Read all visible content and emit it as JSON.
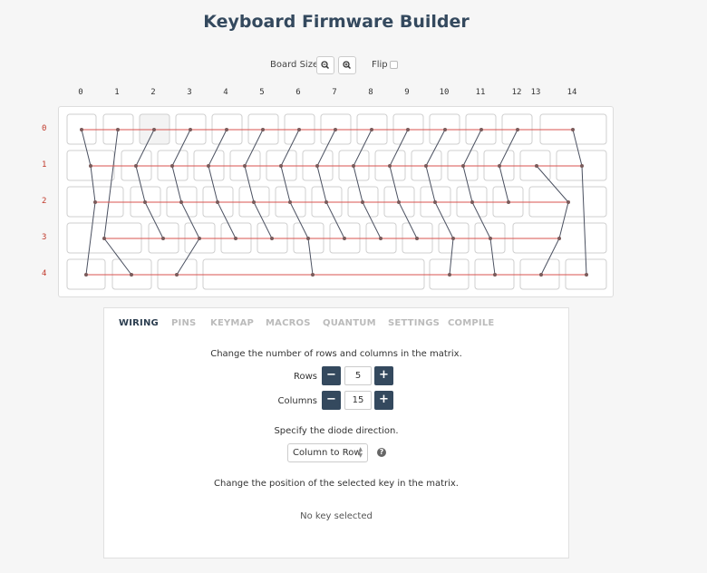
{
  "title": "Keyboard Firmware Builder",
  "toolbar": {
    "board_size_label": "Board Size",
    "zoom_out_icon": "zoom-out-icon",
    "zoom_in_icon": "zoom-in-icon",
    "flip_label": "Flip",
    "flip_checked": false
  },
  "matrix": {
    "col_labels": [
      "0",
      "1",
      "2",
      "3",
      "4",
      "5",
      "6",
      "7",
      "8",
      "9",
      "10",
      "11",
      "12",
      "13",
      "14"
    ],
    "row_labels": [
      "0",
      "1",
      "2",
      "3",
      "4"
    ],
    "wire_color": "#d9534f",
    "col_wire_color": "#4a5060"
  },
  "tabs": [
    "WIRING",
    "PINS",
    "KEYMAP",
    "MACROS",
    "QUANTUM",
    "SETTINGS",
    "COMPILE"
  ],
  "active_tab": "WIRING",
  "wiring": {
    "matrix_text": "Change the number of rows and columns in the matrix.",
    "rows_label": "Rows",
    "rows_value": "5",
    "columns_label": "Columns",
    "columns_value": "15",
    "decrement_label": "−",
    "increment_label": "+",
    "diode_text": "Specify the diode direction.",
    "diode_value": "Column to Row",
    "help_icon": "question-circle-icon",
    "position_text": "Change the position of the selected key in the matrix.",
    "no_key_text": "No key selected"
  },
  "colors": {
    "accent": "#34495e",
    "row_label": "#c0392b"
  }
}
